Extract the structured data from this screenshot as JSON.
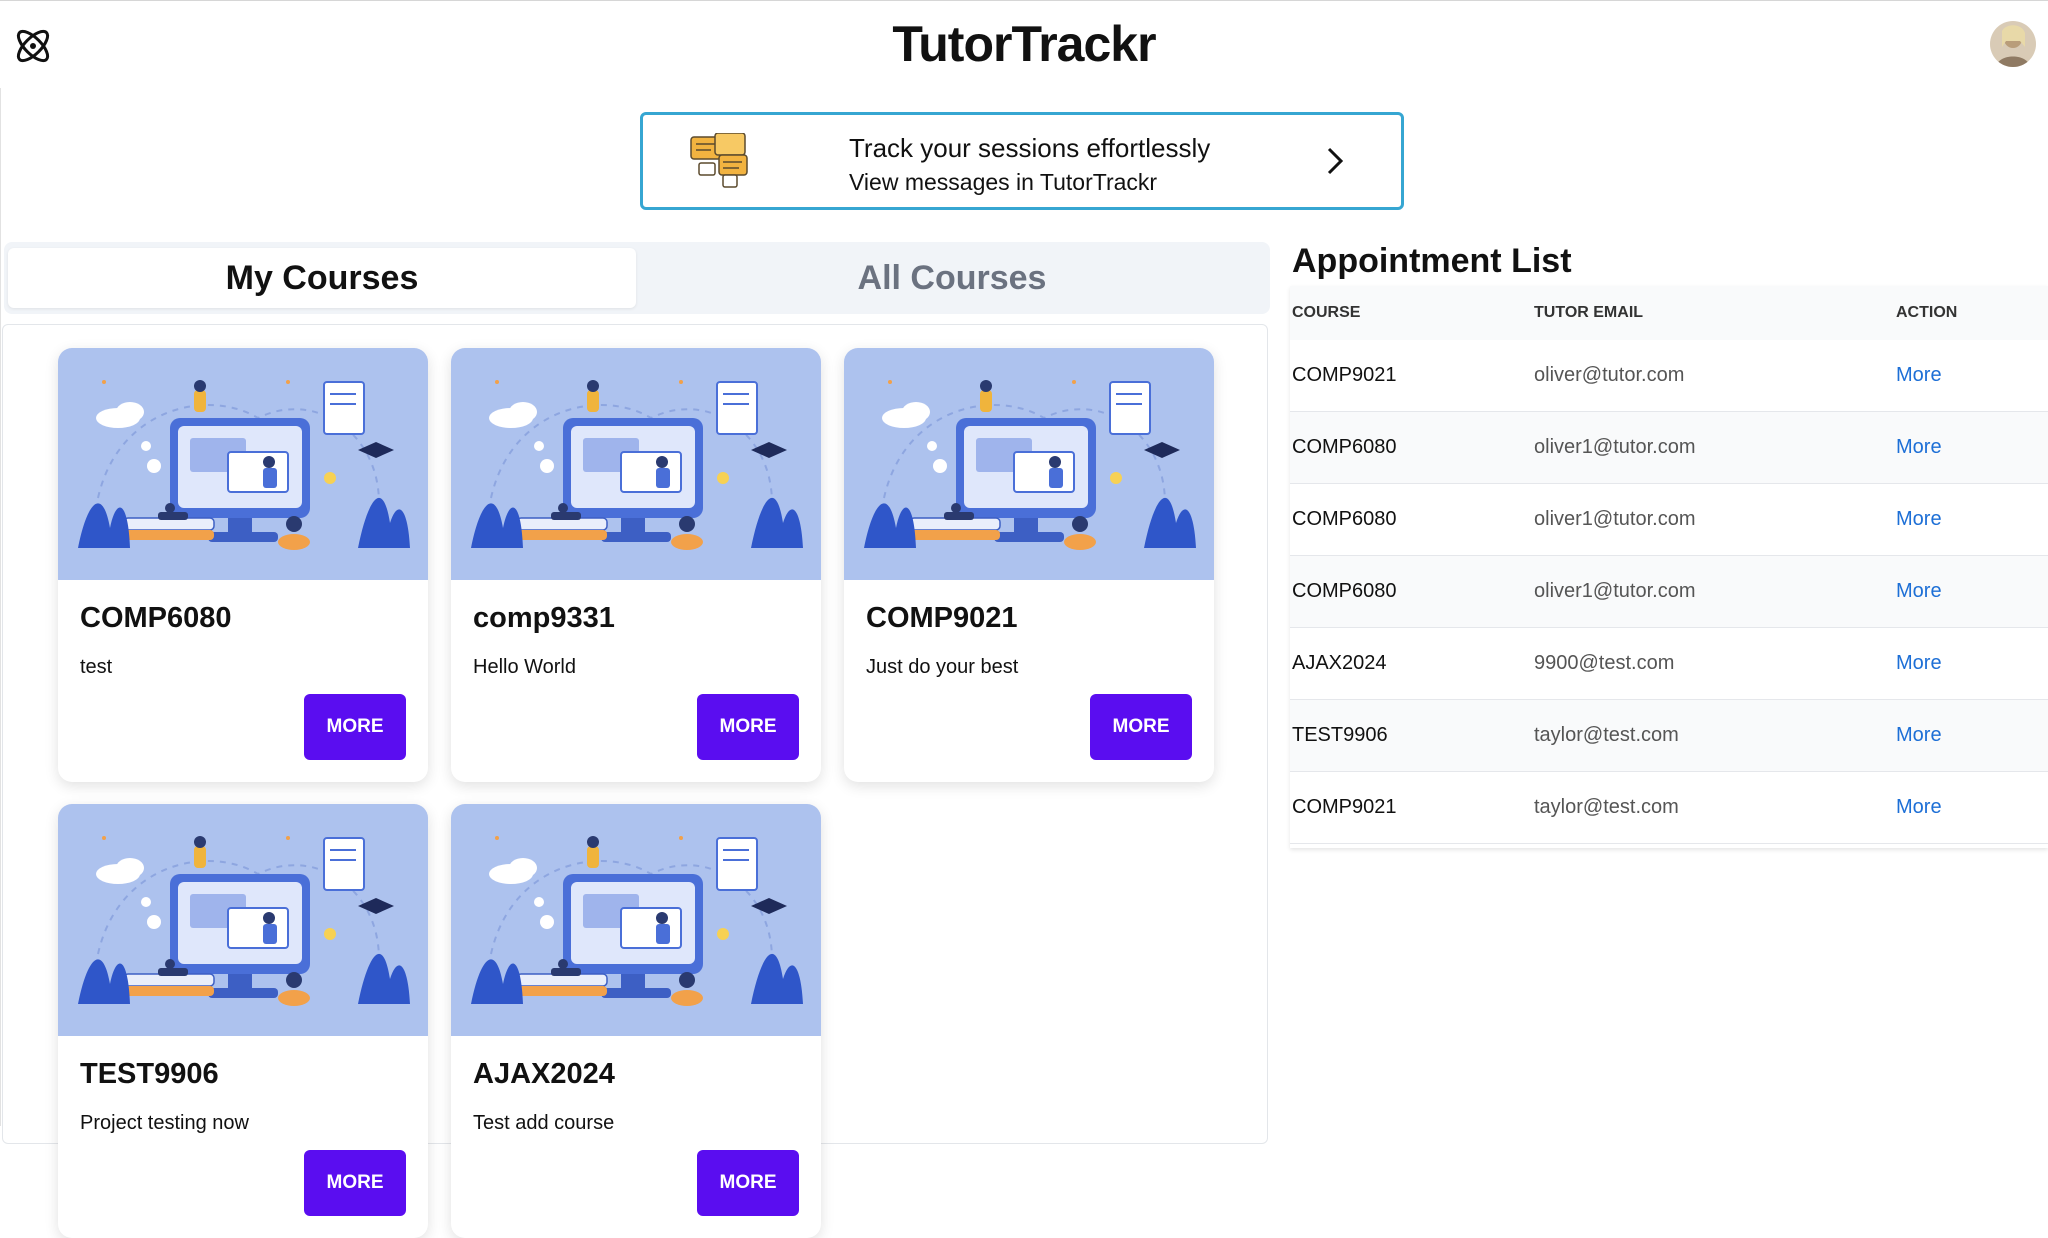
{
  "header": {
    "title": "TutorTrackr",
    "logo_icon": "atom-logo-icon",
    "avatar_icon": "user-avatar"
  },
  "banner": {
    "line1": "Track your sessions effortlessly",
    "line2": "View messages in TutorTrackr",
    "icon": "chat-bubbles-icon",
    "arrow_icon": "chevron-right-icon",
    "border_color": "#36a6d2"
  },
  "tabs": {
    "my_courses": "My Courses",
    "all_courses": "All Courses",
    "active": "My Courses"
  },
  "courses": [
    {
      "code": "COMP6080",
      "description": "test",
      "button": "MORE"
    },
    {
      "code": "comp9331",
      "description": "Hello World",
      "button": "MORE"
    },
    {
      "code": "COMP9021",
      "description": "Just do your best",
      "button": "MORE"
    },
    {
      "code": "TEST9906",
      "description": "Project testing now",
      "button": "MORE"
    },
    {
      "code": "AJAX2024",
      "description": "Test add course",
      "button": "MORE"
    }
  ],
  "appointments": {
    "title": "Appointment List",
    "columns": [
      "COURSE",
      "TUTOR EMAIL",
      "ACTION"
    ],
    "rows": [
      {
        "course": "COMP9021",
        "email": "oliver@tutor.com",
        "action": "More"
      },
      {
        "course": "COMP6080",
        "email": "oliver1@tutor.com",
        "action": "More"
      },
      {
        "course": "COMP6080",
        "email": "oliver1@tutor.com",
        "action": "More"
      },
      {
        "course": "COMP6080",
        "email": "oliver1@tutor.com",
        "action": "More"
      },
      {
        "course": "AJAX2024",
        "email": "9900@test.com",
        "action": "More"
      },
      {
        "course": "TEST9906",
        "email": "taylor@test.com",
        "action": "More"
      },
      {
        "course": "COMP9021",
        "email": "taylor@test.com",
        "action": "More"
      }
    ]
  },
  "colors": {
    "accent_button": "#5a0df0",
    "link": "#1d6fd6",
    "card_illustration_bg": "#adc2ee"
  }
}
